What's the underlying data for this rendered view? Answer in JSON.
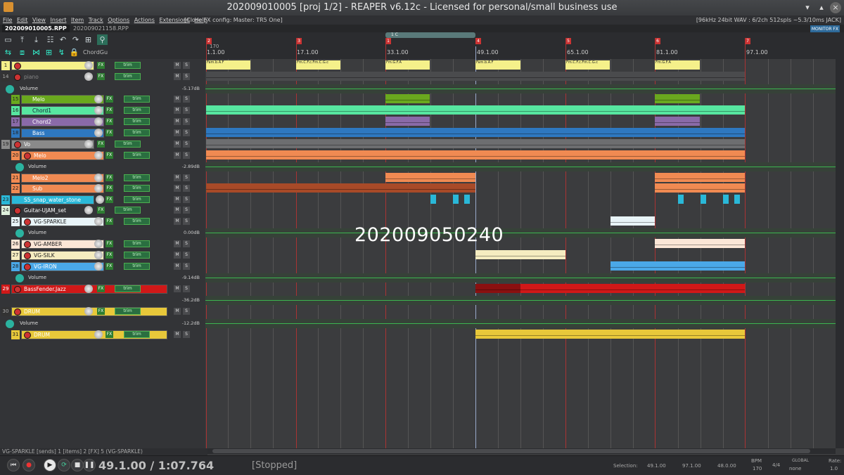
{
  "window": {
    "title": "202009010005 [proj 1/2] - REAPER v6.12c - Licensed for personal/small business use",
    "buttons": {
      "close": "×"
    }
  },
  "menu": {
    "items": [
      "File",
      "Edit",
      "View",
      "Insert",
      "Item",
      "Track",
      "Options",
      "Actions",
      "Extensions",
      "Help"
    ],
    "fx_config": "[Close FX config: Master: TR5 One]",
    "status": "[96kHz 24bit WAV : 6/2ch 512spls ~5.3/10ms JACK]"
  },
  "project_tabs": [
    {
      "label": "202009010005.RPP",
      "active": true
    },
    {
      "label": "202009021158.RPP",
      "active": false
    }
  ],
  "monitor_badge": "MONITOR FX",
  "toolbar": {
    "chord_label": "ChordGu"
  },
  "ruler": {
    "marker_start": "170",
    "bars": [
      "1.1.00",
      "17.1.00",
      "33.1.00",
      "49.1.00",
      "65.1.00",
      "81.1.00",
      "97.1.00"
    ],
    "markers": [
      "2",
      "3",
      "1",
      "4",
      "5",
      "6",
      "7"
    ],
    "time_selection_label": "1 C"
  },
  "tracks": [
    {
      "num": "1",
      "name": "",
      "color": "#f5f08a",
      "fx": "FX",
      "trim": "trim"
    },
    {
      "num": "14",
      "name": "piano",
      "color": "#3a3b3e",
      "fx": "FX",
      "trim": "trim"
    },
    {
      "num": "15",
      "name": "Melo",
      "color": "#6aa81e",
      "fx": "FX",
      "trim": "trim"
    },
    {
      "num": "16",
      "name": "Chord1",
      "color": "#57e6a0",
      "fx": "FX",
      "trim": "trim"
    },
    {
      "num": "17",
      "name": "Chord2",
      "color": "#8a6aa8",
      "fx": "FX",
      "trim": "trim"
    },
    {
      "num": "18",
      "name": "Bass",
      "color": "#2e78c0",
      "fx": "FX",
      "trim": "trim"
    },
    {
      "num": "19",
      "name": "Vo",
      "color": "#8a8a8a",
      "fx": "FX",
      "trim": "trim"
    },
    {
      "num": "20",
      "name": "Melo",
      "color": "#f08a52",
      "fx": "FX",
      "trim": "trim"
    },
    {
      "num": "21",
      "name": "Melo2",
      "color": "#f08a52",
      "fx": "FX",
      "trim": "trim"
    },
    {
      "num": "22",
      "name": "Sub",
      "color": "#f08a52",
      "fx": "FX",
      "trim": "trim"
    },
    {
      "num": "23",
      "name": "S5_snap_water_stone",
      "color": "#2ab8d8",
      "fx": "FX",
      "trim": "trim"
    },
    {
      "num": "24",
      "name": "Guitar-UJAM_set",
      "color": "#dff0dc",
      "fx": "FX",
      "trim": "trim"
    },
    {
      "num": "25",
      "name": "VG-SPARKLE",
      "color": "#e8f4f8",
      "fx": "FX",
      "trim": "trim"
    },
    {
      "num": "26",
      "name": "VG-AMBER",
      "color": "#fbe6d6",
      "fx": "FX",
      "trim": "trim"
    },
    {
      "num": "27",
      "name": "VG-SILK",
      "color": "#f5ecc0",
      "fx": "FX",
      "trim": "trim"
    },
    {
      "num": "28",
      "name": "VG-IRON",
      "color": "#4aa8e8",
      "fx": "FX",
      "trim": "trim"
    },
    {
      "num": "29",
      "name": "BassFender.Jazz",
      "color": "#d01818",
      "fx": "FX",
      "trim": "trim"
    },
    {
      "num": "30",
      "name": "DRUM",
      "color": "#e8c83a",
      "fx": "FX",
      "trim": "trim"
    },
    {
      "num": "31",
      "name": "DRUM",
      "color": "#e8c83a",
      "fx": "FX",
      "trim": "trim"
    }
  ],
  "envelopes": [
    {
      "label": "Volume",
      "db": "-5.17dB"
    },
    {
      "label": "Volume",
      "db": "-2.89dB"
    },
    {
      "label": "Volume",
      "db": "0.00dB"
    },
    {
      "label": "Volume",
      "db": "-9.14dB"
    },
    {
      "label": "Volume",
      "db": "-36.2dB"
    },
    {
      "label": "Volume",
      "db": "-12.2dB"
    }
  ],
  "item_labels": {
    "a": "Fam.b.A.F",
    "b": "Fm.C.F.c.Fm.C.G.c",
    "c": "Fm.G.F.A",
    "d": "Fam.b.A.F",
    "e": "Fm.C.F.c.Fm.C.G.c",
    "f": "Fm.G.F.A"
  },
  "overlay_text": "202009050240",
  "status_line": "VG-SPARKLE [sends] 1 [items] 2 [FX] 5 (VG-SPARKLE)",
  "transport": {
    "position": "49.1.00 / 1:07.764",
    "state": "[Stopped]",
    "selection_label": "Selection:",
    "sel_start": "49.1.00",
    "sel_end": "97.1.00",
    "sel_len": "48.0.00",
    "bpm_label": "BPM",
    "bpm": "170",
    "timesig": "4/4",
    "global_label": "GLOBAL",
    "global_val": "none",
    "rate_label": "Rate:",
    "rate": "1.0"
  }
}
